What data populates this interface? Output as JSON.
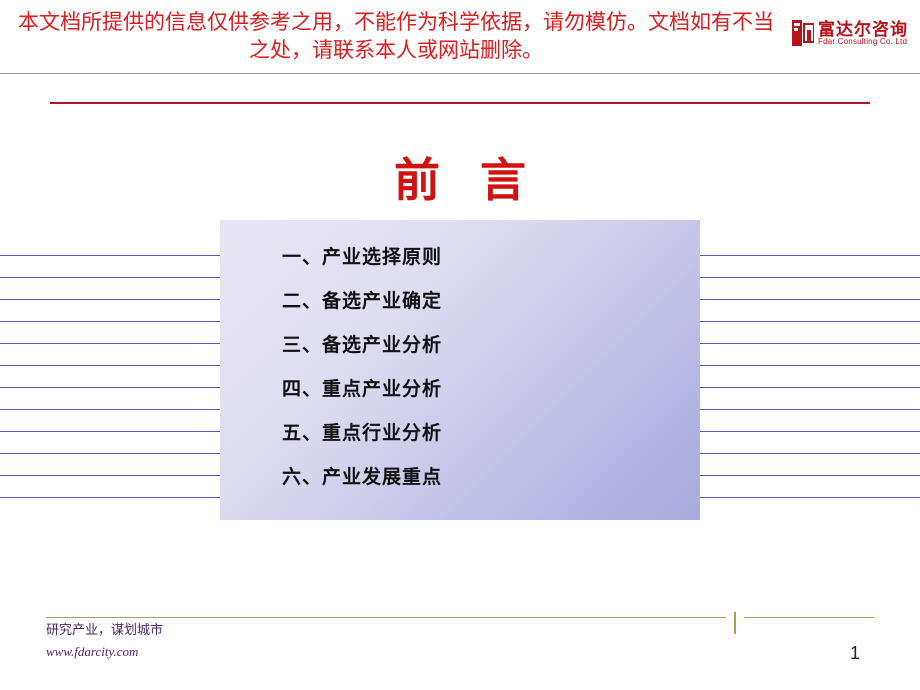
{
  "disclaimer": "本文档所提供的信息仅供参考之用，不能作为科学依据，请勿模仿。文档如有不当之处，请联系本人或网站删除。",
  "brand": {
    "name_cn": "富达尔咨询",
    "name_en": "Fdar Consulting Co. Ltd"
  },
  "title": "前言",
  "toc": [
    "一、产业选择原则",
    "二、备选产业确定",
    "三、备选产业分析",
    "四、重点产业分析",
    "五、重点行业分析",
    "六、产业发展重点"
  ],
  "footer": {
    "tagline": "研究产业，谋划城市",
    "url": "www.fdarcity.com"
  },
  "page_number": "1"
}
